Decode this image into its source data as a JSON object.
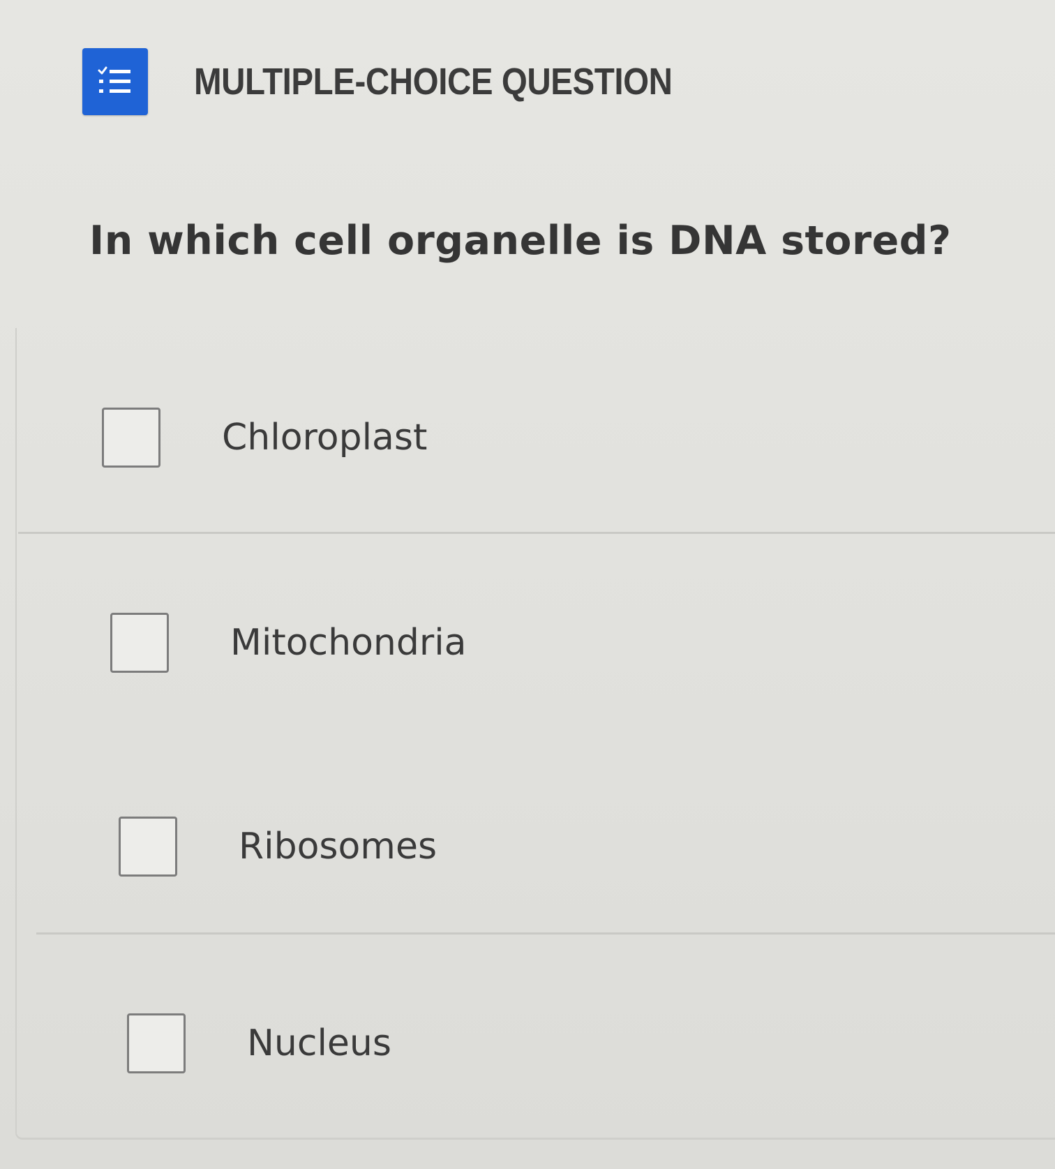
{
  "question_card": {
    "type_icon": "checklist-icon",
    "type_label": "MULTIPLE-CHOICE QUESTION",
    "question_text": "In which cell organelle is DNA stored?",
    "options": [
      {
        "label": "Chloroplast",
        "checked": false
      },
      {
        "label": "Mitochondria",
        "checked": false
      },
      {
        "label": "Ribosomes",
        "checked": false
      },
      {
        "label": "Nucleus",
        "checked": false
      }
    ]
  },
  "colors": {
    "accent": "#1f63d6",
    "text": "#3a3a3a",
    "background": "#e3e3df"
  }
}
